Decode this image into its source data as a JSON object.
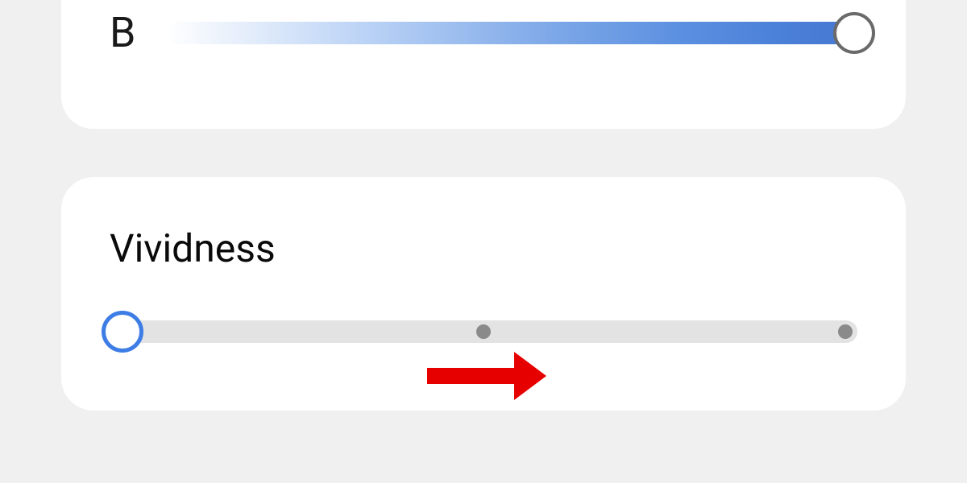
{
  "sliders": {
    "b": {
      "label": "B",
      "gradient_start": "#ffffff",
      "gradient_end": "#4778d0",
      "thumb_border": "#6a6a6a",
      "value_percent": 100
    },
    "vividness": {
      "title": "Vividness",
      "track_color": "#e3e3e3",
      "thumb_border": "#3d7de5",
      "tick_color": "#8a8a8a",
      "value_percent": 0
    }
  },
  "annotation": {
    "arrow_color": "#e60000",
    "direction": "right"
  }
}
